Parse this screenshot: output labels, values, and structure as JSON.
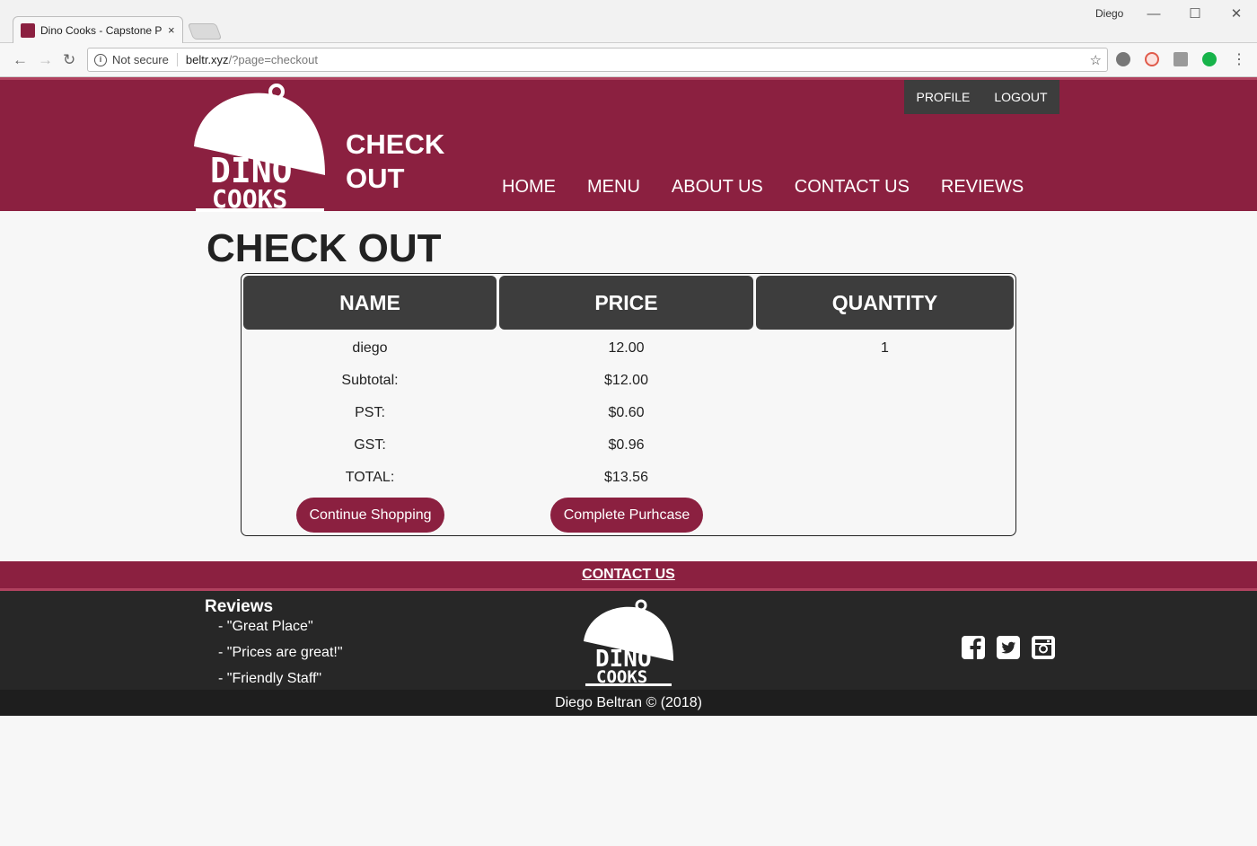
{
  "browser": {
    "tab_title": "Dino Cooks - Capstone P",
    "tab_close": "×",
    "window_user": "Diego",
    "security_label": "Not secure",
    "url_host": "beltr.xyz",
    "url_path": "/?page=checkout"
  },
  "header": {
    "logo_line1": "DINO",
    "logo_line2": "COOKS",
    "title_line1": "CHECK",
    "title_line2": "OUT",
    "account_links": [
      "PROFILE",
      "LOGOUT"
    ],
    "nav": [
      "HOME",
      "MENU",
      "ABOUT US",
      "CONTACT US",
      "REVIEWS"
    ]
  },
  "page": {
    "title": "CHECK OUT"
  },
  "cart": {
    "headers": [
      "NAME",
      "PRICE",
      "QUANTITY"
    ],
    "items": [
      {
        "name": "diego",
        "price": "12.00",
        "quantity": "1"
      }
    ],
    "summary": [
      {
        "label": "Subtotal:",
        "value": "$12.00"
      },
      {
        "label": "PST:",
        "value": "$0.60"
      },
      {
        "label": "GST:",
        "value": "$0.96"
      },
      {
        "label": "TOTAL:",
        "value": "$13.56"
      }
    ],
    "continue_label": "Continue Shopping",
    "complete_label": "Complete Purhcase"
  },
  "footer": {
    "contact_label": "CONTACT US",
    "reviews_title": "Reviews",
    "reviews": [
      "- \"Great Place\"",
      "- \"Prices are great!\"",
      "- \"Friendly Staff\""
    ],
    "logo_line1": "DINO",
    "logo_line2": "COOKS",
    "social_icons": [
      "facebook-icon",
      "twitter-icon",
      "instagram-icon"
    ],
    "copyright": "Diego Beltran © (2018)"
  },
  "colors": {
    "brand": "#8b2040",
    "brand_light": "#b0425f",
    "dark": "#3d3d3d",
    "footer_dark": "#272727"
  }
}
